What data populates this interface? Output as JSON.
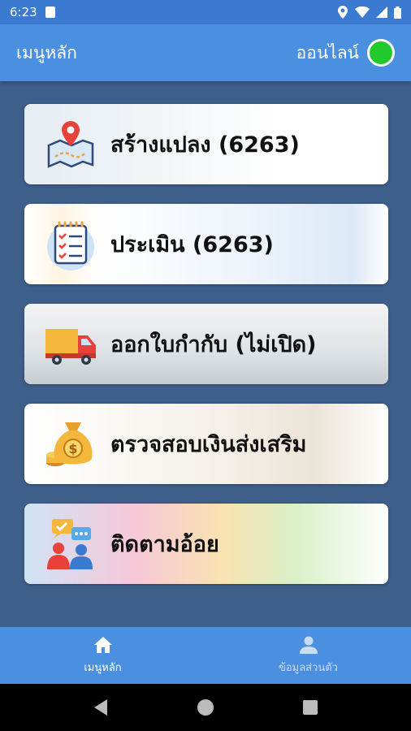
{
  "status_bar": {
    "time": "6:23"
  },
  "app_bar": {
    "title": "เมนูหลัก",
    "status_label": "ออนไลน์",
    "status_color": "#22c92c"
  },
  "menu": [
    {
      "label": "สร้างแปลง (6263)",
      "icon": "map-pin-icon"
    },
    {
      "label": "ประเมิน (6263)",
      "icon": "checklist-icon"
    },
    {
      "label": "ออกใบกำกับ (ไม่เปิด)",
      "icon": "truck-icon"
    },
    {
      "label": "ตรวจสอบเงินส่งเสริม",
      "icon": "money-bag-icon"
    },
    {
      "label": "ติดตามอ้อย",
      "icon": "people-chat-icon"
    }
  ],
  "bottom_nav": [
    {
      "label": "เมนูหลัก",
      "icon": "home-icon",
      "active": true
    },
    {
      "label": "ข้อมูลส่วนตัว",
      "icon": "person-icon",
      "active": false
    }
  ]
}
